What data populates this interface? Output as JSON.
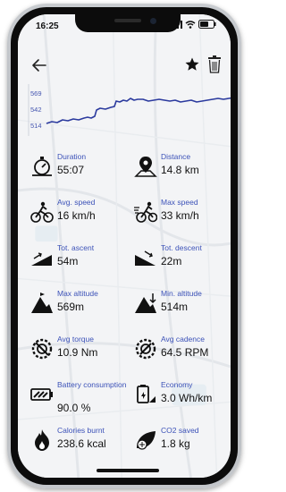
{
  "status_bar": {
    "time": "16:25"
  },
  "chart": {
    "ticks": [
      "569",
      "542",
      "514"
    ]
  },
  "chart_data": {
    "type": "line",
    "y_ticks": [
      569,
      542,
      514
    ],
    "ylim": [
      510,
      575
    ]
  },
  "stats": [
    {
      "label": "Duration",
      "value": "55:07",
      "icon": "stopwatch-icon"
    },
    {
      "label": "Distance",
      "value": "14.8 km",
      "icon": "map-pin-icon"
    },
    {
      "label": "Avg. speed",
      "value": "16 km/h",
      "icon": "cyclist-icon"
    },
    {
      "label": "Max speed",
      "value": "33 km/h",
      "icon": "fast-cyclist-icon"
    },
    {
      "label": "Tot. ascent",
      "value": "54m",
      "icon": "ascent-icon"
    },
    {
      "label": "Tot. descent",
      "value": "22m",
      "icon": "descent-icon"
    },
    {
      "label": "Max altitude",
      "value": "569m",
      "icon": "max-altitude-icon"
    },
    {
      "label": "Min. altitude",
      "value": "514m",
      "icon": "min-altitude-icon"
    },
    {
      "label": "Avg torque",
      "value": "10.9 Nm",
      "icon": "torque-icon"
    },
    {
      "label": "Avg cadence",
      "value": "64.5 RPM",
      "icon": "cadence-icon"
    },
    {
      "label": "Battery consumption",
      "value": "90.0 %",
      "icon": "battery-icon"
    },
    {
      "label": "Economy",
      "value": "3.0 Wh/km",
      "icon": "economy-icon"
    },
    {
      "label": "Calories burnt",
      "value": "238.6 kcal",
      "icon": "flame-icon"
    },
    {
      "label": "CO2 saved",
      "value": "1.8 kg",
      "icon": "leaf-icon"
    }
  ]
}
